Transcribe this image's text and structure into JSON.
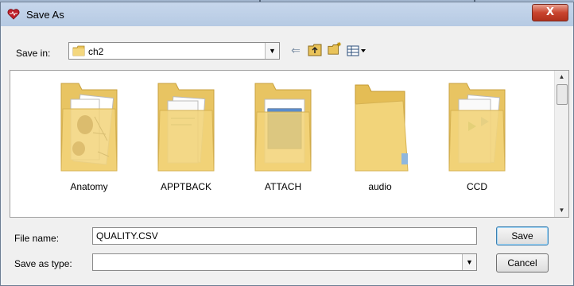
{
  "dialog": {
    "title": "Save As",
    "close_label": "X"
  },
  "toolbar": {
    "save_in_label": "Save in:",
    "save_in_value": "ch2",
    "icons": [
      "back-arrow-icon",
      "up-folder-icon",
      "new-folder-icon",
      "view-menu-icon"
    ]
  },
  "folders": [
    {
      "name": "Anatomy",
      "preview": "photos"
    },
    {
      "name": "APPTBACK",
      "preview": "documents"
    },
    {
      "name": "ATTACH",
      "preview": "window"
    },
    {
      "name": "audio",
      "preview": "empty"
    },
    {
      "name": "CCD",
      "preview": "documents"
    }
  ],
  "form": {
    "file_name_label": "File name:",
    "file_name_value": "QUALITY.CSV",
    "save_as_type_label": "Save as type:",
    "save_as_type_value": ""
  },
  "buttons": {
    "save_label": "Save",
    "cancel_label": "Cancel"
  },
  "colors": {
    "folder": "#f2d47a",
    "close_button": "#c9442e",
    "titlebar": "#c0d2ea"
  }
}
